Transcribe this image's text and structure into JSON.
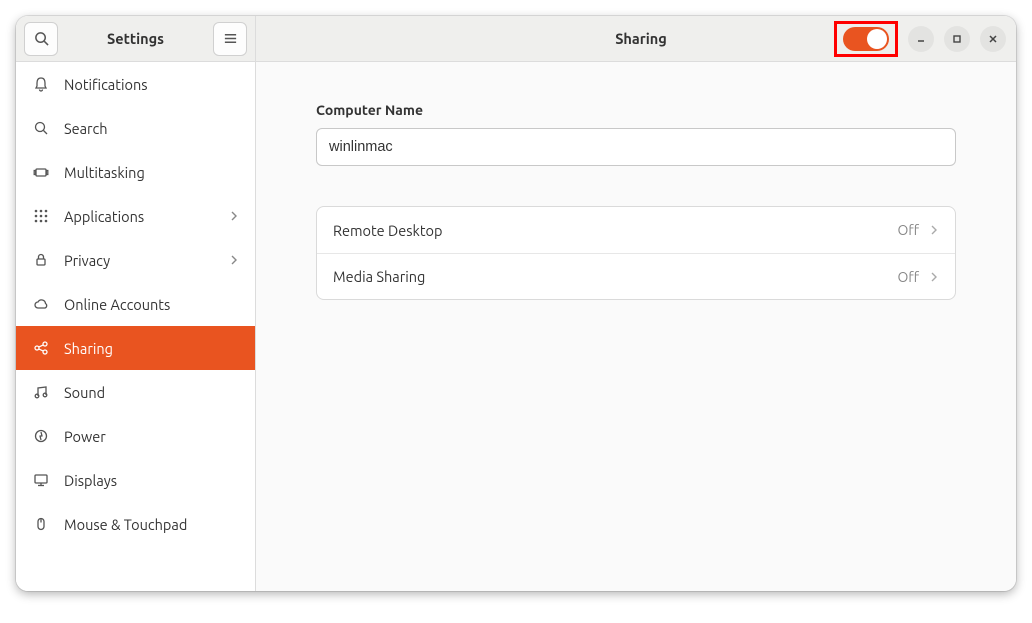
{
  "sidebar": {
    "title": "Settings",
    "items": [
      {
        "label": "Notifications",
        "sub": false
      },
      {
        "label": "Search",
        "sub": false
      },
      {
        "label": "Multitasking",
        "sub": false
      },
      {
        "label": "Applications",
        "sub": true
      },
      {
        "label": "Privacy",
        "sub": true
      },
      {
        "label": "Online Accounts",
        "sub": false
      },
      {
        "label": "Sharing",
        "sub": false,
        "active": true
      },
      {
        "label": "Sound",
        "sub": false
      },
      {
        "label": "Power",
        "sub": false
      },
      {
        "label": "Displays",
        "sub": false
      },
      {
        "label": "Mouse & Touchpad",
        "sub": false
      }
    ]
  },
  "main": {
    "title": "Sharing",
    "computer_name_label": "Computer Name",
    "computer_name_value": "winlinmac",
    "options": [
      {
        "name": "Remote Desktop",
        "state": "Off"
      },
      {
        "name": "Media Sharing",
        "state": "Off"
      }
    ]
  }
}
